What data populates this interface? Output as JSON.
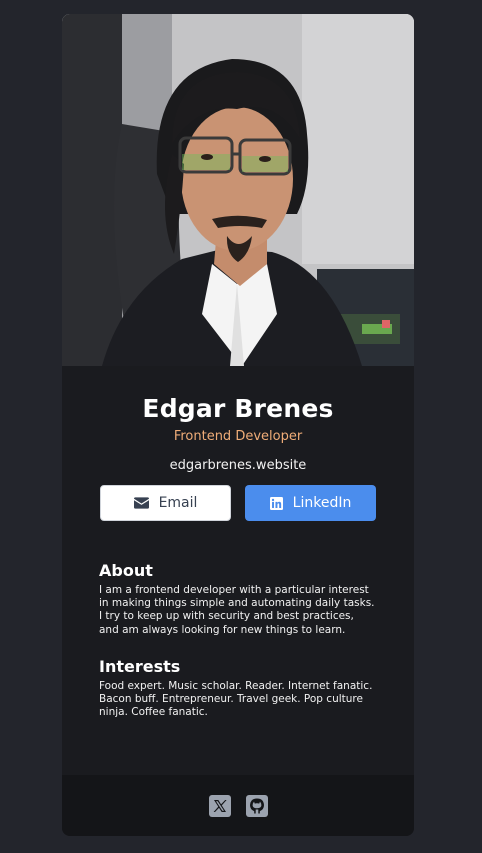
{
  "profile": {
    "name": "Edgar Brenes",
    "title": "Frontend Developer",
    "website": "edgarbrenes.website"
  },
  "buttons": {
    "email_label": "Email",
    "linkedin_label": "LinkedIn"
  },
  "about": {
    "heading": "About",
    "text": "I am a frontend developer with a particular interest in making things simple and automating daily tasks. I try to keep up with security and best practices, and am always looking for new things to learn."
  },
  "interests": {
    "heading": "Interests",
    "text": "Food expert. Music scholar. Reader. Internet fanatic. Bacon buff. Entrepreneur. Travel geek. Pop culture ninja. Coffee fanatic."
  },
  "footer": {
    "icons": [
      "x-twitter-icon",
      "github-icon"
    ]
  },
  "colors": {
    "background": "#23252c",
    "card": "#1a1b1f",
    "footer": "#141518",
    "accent": "#f0ad78",
    "linkedin": "#4b8ded"
  }
}
